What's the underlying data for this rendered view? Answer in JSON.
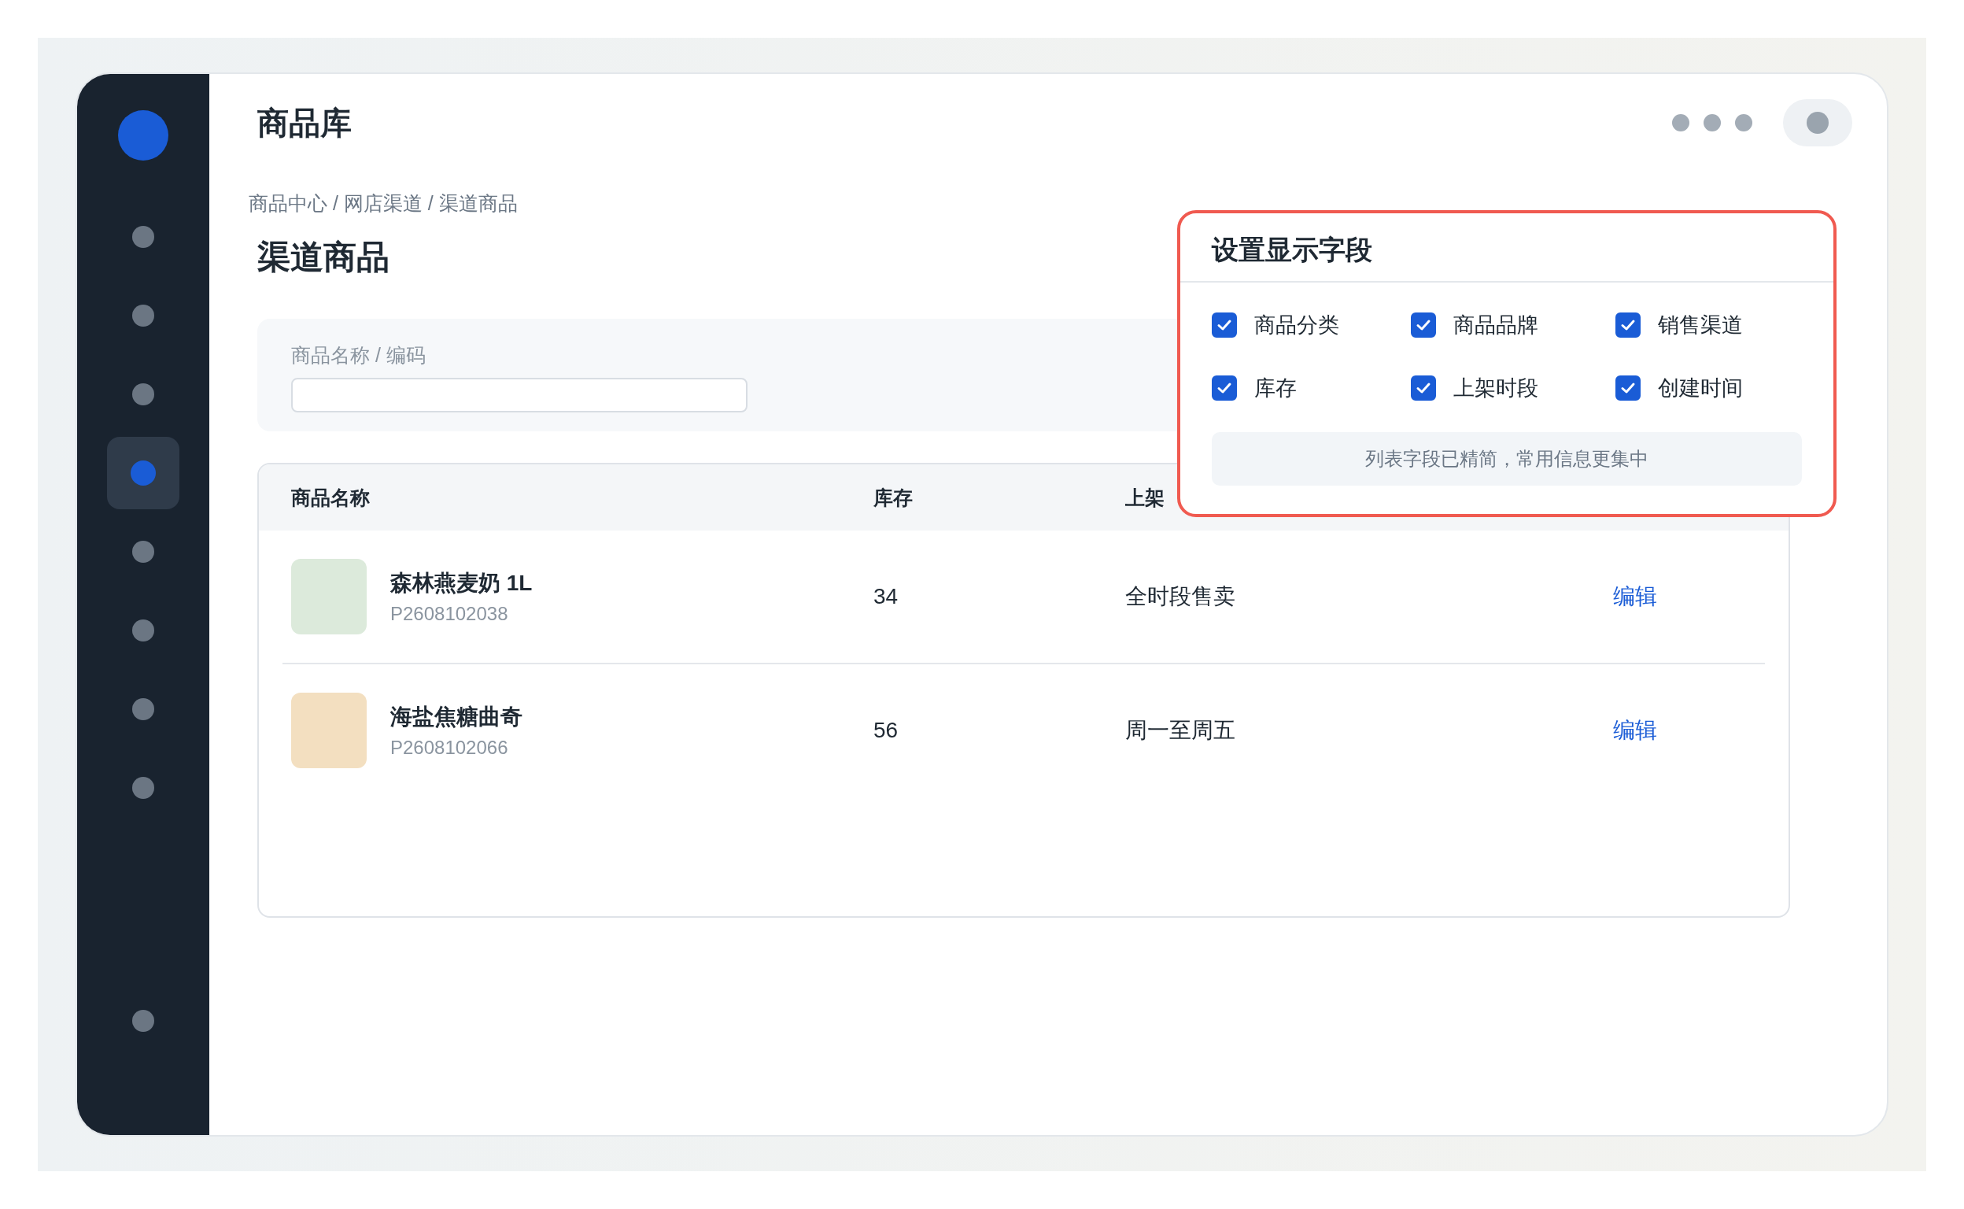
{
  "app_title": "商品库",
  "sidebar": {
    "items": [
      {
        "selected": false
      },
      {
        "selected": false
      },
      {
        "selected": false
      },
      {
        "selected": true
      },
      {
        "selected": false
      },
      {
        "selected": false
      },
      {
        "selected": false
      },
      {
        "selected": false
      }
    ],
    "bottom_items": [
      {
        "selected": false
      }
    ]
  },
  "breadcrumb": "商品中心 / 网店渠道 / 渠道商品",
  "page_title": "渠道商品",
  "search": {
    "label": "商品名称 / 编码"
  },
  "table": {
    "columns": [
      "商品名称",
      "库存",
      "上架"
    ],
    "rows": [
      {
        "name": "森林燕麦奶 1L",
        "code": "P2608102038",
        "color": "#dceadb",
        "stock": "34",
        "period": "全时段售卖",
        "action": "编辑"
      },
      {
        "name": "海盐焦糖曲奇",
        "code": "P2608102066",
        "color": "#f3dfc0",
        "stock": "56",
        "period": "周一至周五",
        "action": "编辑"
      }
    ]
  },
  "field_settings": {
    "title": "设置显示字段",
    "fields": [
      {
        "label": "商品分类",
        "checked": true
      },
      {
        "label": "商品品牌",
        "checked": true
      },
      {
        "label": "销售渠道",
        "checked": true
      },
      {
        "label": "库存",
        "checked": true
      },
      {
        "label": "上架时段",
        "checked": true
      },
      {
        "label": "创建时间",
        "checked": true
      }
    ],
    "note": "列表字段已精简，常用信息更集中"
  }
}
